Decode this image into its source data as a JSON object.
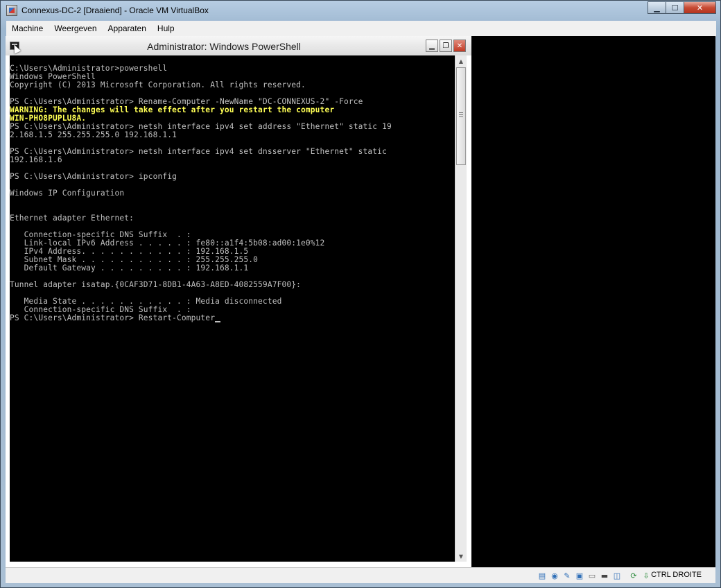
{
  "vbox": {
    "title": "Connexus-DC-2 [Draaiend] - Oracle VM VirtualBox",
    "controls": {
      "minimize": "▁",
      "maximize": "☐",
      "close": "✕"
    },
    "menu": [
      "Machine",
      "Weergeven",
      "Apparaten",
      "Hulp"
    ],
    "status": {
      "host_key_label": "CTRL DROITE",
      "icons": [
        "hard-disk-icon",
        "optical-drive-icon",
        "usb-icon",
        "shared-folders-icon",
        "display-icon",
        "video-capture-icon",
        "network-icon",
        "mouse-integration-icon",
        "host-key-icon"
      ]
    }
  },
  "powershell": {
    "title": "Administrator: Windows PowerShell",
    "controls": {
      "minimize": "▁",
      "restore": "❐",
      "close": "✕"
    },
    "console_lines": [
      "C:\\Users\\Administrator>powershell",
      "Windows PowerShell",
      "Copyright (C) 2013 Microsoft Corporation. All rights reserved.",
      "",
      "PS C:\\Users\\Administrator> Rename-Computer -NewName \"DC-CONNEXUS-2\" -Force",
      "WARNING: The changes will take effect after you restart the computer",
      "WIN-PHO8PUPLU8A.",
      "PS C:\\Users\\Administrator> netsh interface ipv4 set address \"Ethernet\" static 19",
      "2.168.1.5 255.255.255.0 192.168.1.1",
      "",
      "PS C:\\Users\\Administrator> netsh interface ipv4 set dnsserver \"Ethernet\" static",
      "192.168.1.6",
      "",
      "PS C:\\Users\\Administrator> ipconfig",
      "",
      "Windows IP Configuration",
      "",
      "",
      "Ethernet adapter Ethernet:",
      "",
      "   Connection-specific DNS Suffix  . :",
      "   Link-local IPv6 Address . . . . . : fe80::a1f4:5b08:ad00:1e0%12",
      "   IPv4 Address. . . . . . . . . . . : 192.168.1.5",
      "   Subnet Mask . . . . . . . . . . . : 255.255.255.0",
      "   Default Gateway . . . . . . . . . : 192.168.1.1",
      "",
      "Tunnel adapter isatap.{0CAF3D71-8DB1-4A63-A8ED-4082559A7F00}:",
      "",
      "   Media State . . . . . . . . . . . : Media disconnected",
      "   Connection-specific DNS Suffix  . :",
      "PS C:\\Users\\Administrator> Restart-Computer"
    ],
    "warning_line_indices": [
      5,
      6
    ],
    "scrollbar": {
      "up": "▲",
      "down": "▼"
    }
  }
}
